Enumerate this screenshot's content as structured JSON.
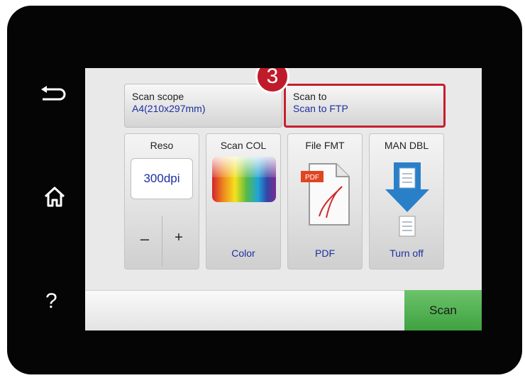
{
  "side": {
    "back_icon": "back-arrow-icon",
    "home_icon": "home-icon",
    "help_label": "?"
  },
  "step_badge": "3",
  "scan_scope": {
    "label": "Scan scope",
    "value": "A4(210x297mm)"
  },
  "scan_to": {
    "label": "Scan to",
    "value": "Scan to FTP"
  },
  "tiles": {
    "reso": {
      "title": "Reso",
      "value": "300dpi",
      "minus": "–",
      "plus": "+"
    },
    "scan_col": {
      "title": "Scan COL",
      "value": "Color"
    },
    "file_fmt": {
      "title": "File FMT",
      "value": "PDF",
      "icon_text": "PDF"
    },
    "man_dbl": {
      "title": "MAN DBL",
      "value": "Turn off"
    }
  },
  "scan_button": "Scan",
  "colors": {
    "highlight": "#c61e2e",
    "value_text": "#1c2fa0",
    "scan_green": "#4fae50"
  }
}
